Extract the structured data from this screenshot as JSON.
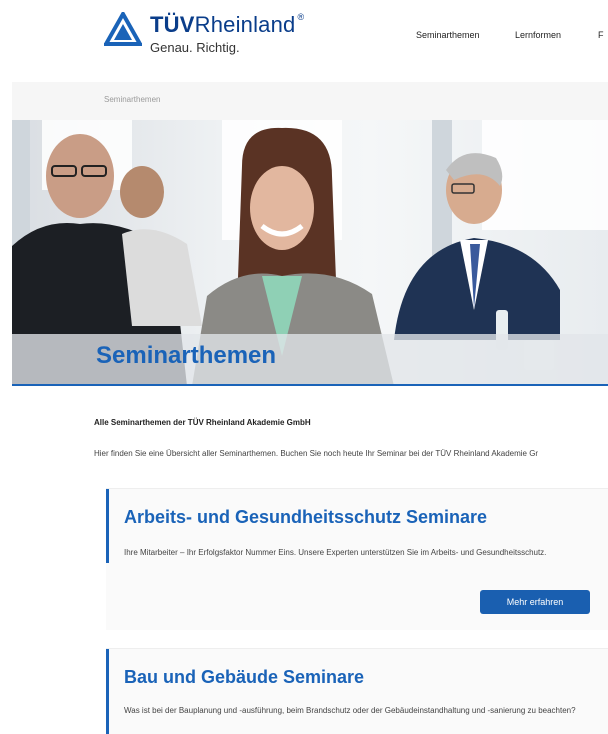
{
  "header": {
    "brand_bold": "TÜV",
    "brand_light": "Rheinland",
    "brand_reg": "®",
    "tagline": "Genau. Richtig.",
    "nav": [
      "Seminarthemen",
      "Lernformen",
      "F"
    ]
  },
  "breadcrumb": {
    "current": "Seminarthemen"
  },
  "hero": {
    "title": "Seminarthemen"
  },
  "intro": {
    "title": "Alle Seminarthemen der TÜV Rheinland Akademie GmbH",
    "text": "Hier finden Sie eine Übersicht aller Seminarthemen. Buchen Sie noch heute Ihr Seminar bei der TÜV Rheinland Akademie Gr"
  },
  "cards": [
    {
      "title": "Arbeits- und Gesundheitsschutz Seminare",
      "text": "Ihre Mitarbeiter – Ihr Erfolgsfaktor Nummer Eins. Unsere Experten unterstützen Sie im Arbeits- und Gesundheitsschutz.",
      "button": "Mehr erfahren"
    },
    {
      "title": "Bau und Gebäude Seminare",
      "text": "Was ist bei der Bauplanung und -ausführung, beim Brandschutz oder der Gebäudeinstandhaltung und -sanierung zu beachten?"
    }
  ],
  "colors": {
    "brand_blue": "#1a63b8",
    "button_blue": "#1a5fb0",
    "logo_blue": "#0a3d8a"
  },
  "icons": {
    "logo": "tuv-triangle-logo"
  }
}
